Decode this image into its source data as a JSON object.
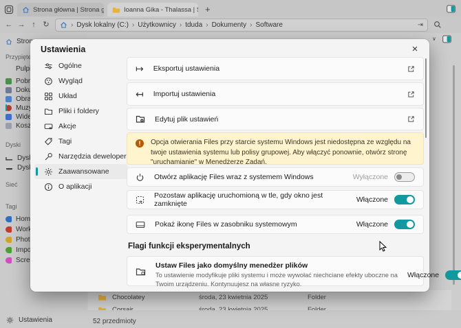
{
  "colors": {
    "accent": "#12999f",
    "warning_bg": "#fff4ce",
    "warning_icon": "#b45a00",
    "folder": "#e8b339",
    "tab_home_icon": "#3b78c2"
  },
  "icons": {
    "back": "←",
    "forward": "→",
    "up": "↑",
    "refresh": "↻",
    "chevron": "›",
    "close": "×",
    "new_tab": "+",
    "goto": "⇥",
    "export": "↦",
    "import": "↤",
    "dropdown": "∨",
    "music_note": "♪"
  },
  "window": {
    "tabs": [
      {
        "label": "Strona główna | Strona główna"
      },
      {
        "label": "Ioanna Gika - Thalassa | Softw"
      }
    ],
    "breadcrumb": [
      "Dysk lokalny (C:)",
      "Użytkownicy",
      "tduda",
      "Dokumenty",
      "Software"
    ]
  },
  "sidebar": {
    "home_label": "Strona",
    "pinned_label": "Przypięte",
    "pinned": [
      {
        "label": "Pulpit"
      },
      {
        "label": "Pobra"
      },
      {
        "label": "Doku"
      },
      {
        "label": "Obraz"
      },
      {
        "label": "Muzy"
      },
      {
        "label": "Wide"
      },
      {
        "label": "Kosz"
      }
    ],
    "drives_label": "Dyski",
    "drives": [
      {
        "label": "Dysk l"
      },
      {
        "label": "Dysk"
      }
    ],
    "network_label": "Sieć",
    "tags_label": "Tagi",
    "tags": [
      {
        "label": "Home",
        "color": "#2f6fc2"
      },
      {
        "label": "Work",
        "color": "#c23b2f"
      },
      {
        "label": "Photo",
        "color": "#d1a32a"
      },
      {
        "label": "Impor",
        "color": "#4f9e33"
      },
      {
        "label": "Scree",
        "color": "#d14fc0"
      }
    ],
    "settings_label": "Ustawienia"
  },
  "files": {
    "rows": [
      {
        "name": "Chocolatey",
        "date": "środa, 23 kwietnia 2025",
        "type": "Folder"
      },
      {
        "name": "Corsair",
        "date": "środa, 23 kwietnia 2025",
        "type": "Folder"
      }
    ]
  },
  "statusbar": {
    "count": "52 przedmioty"
  },
  "dialog": {
    "title": "Ustawienia",
    "nav": [
      {
        "label": "Ogólne"
      },
      {
        "label": "Wygląd"
      },
      {
        "label": "Układ"
      },
      {
        "label": "Pliki i foldery"
      },
      {
        "label": "Akcje"
      },
      {
        "label": "Tagi"
      },
      {
        "label": "Narzędzia deweloperskie"
      },
      {
        "label": "Zaawansowane"
      },
      {
        "label": "O aplikacji"
      }
    ],
    "selected_nav": "Zaawansowane",
    "actions": [
      {
        "label": "Eksportuj ustawienia"
      },
      {
        "label": "Importuj ustawienia"
      },
      {
        "label": "Edytuj plik ustawień"
      }
    ],
    "warning": "Opcja otwierania Files przy starcie systemu Windows jest niedostępna ze względu na twoje ustawienia systemu lub polisy grupowej. Aby włączyć ponownie, otwórz stronę \"uruchamianie\" w Menedżerze Zadań.",
    "toggles": [
      {
        "label": "Otwórz aplikację Files wraz z systemem Windows",
        "state": "Wyłączone",
        "on": false
      },
      {
        "label": "Pozostaw aplikację uruchomioną w tle, gdy okno jest zamknięte",
        "state": "Włączone",
        "on": true
      },
      {
        "label": "Pokaż ikonę Files w zasobniku systemowym",
        "state": "Włączone",
        "on": true
      }
    ],
    "flags_heading": "Flagi funkcji eksperymentalnych",
    "flag": {
      "title": "Ustaw Files jako domyślny menedżer plików",
      "desc": "To ustawienie modyfikuje pliki systemu i może wywołać niechciane efekty uboczne na Twoim urządzeniu. Kontynuujesz na własne ryzyko.",
      "state": "Włączone",
      "on": true
    }
  }
}
